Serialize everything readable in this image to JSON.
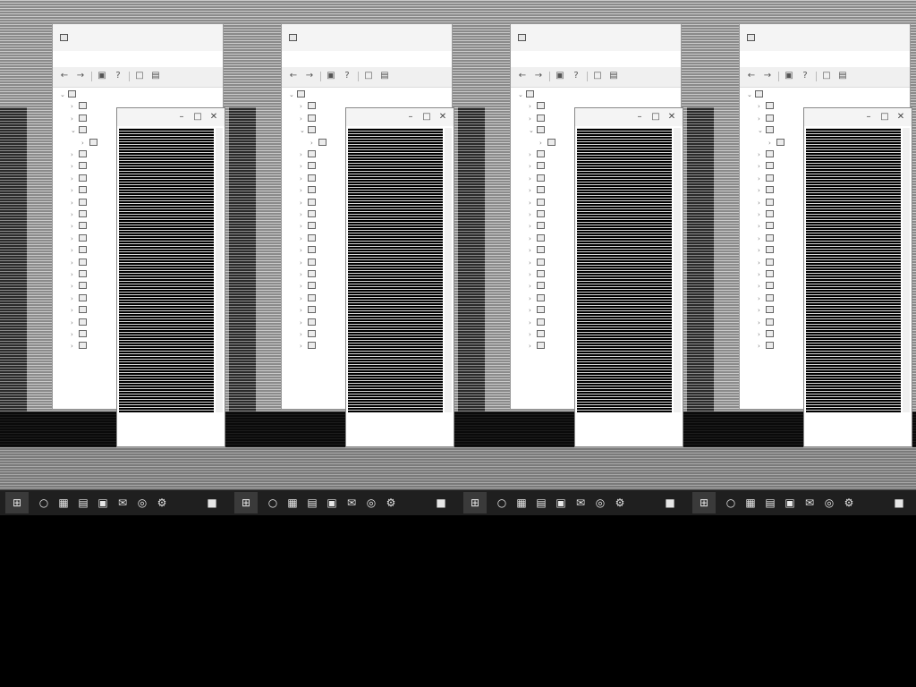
{
  "screen": {
    "panes": [
      {
        "window": {
          "title": "",
          "menu": [
            "",
            "",
            ""
          ]
        }
      },
      {
        "window": {
          "title": "",
          "menu": [
            "",
            "",
            ""
          ]
        }
      },
      {
        "window": {
          "title": "",
          "menu": [
            "",
            "",
            ""
          ]
        }
      },
      {
        "window": {
          "title": "",
          "menu": [
            "",
            "",
            ""
          ]
        }
      }
    ]
  },
  "device_manager": {
    "toolbar_icons": [
      "back-icon",
      "forward-icon",
      "properties-icon",
      "help-icon",
      "scan-icon",
      "display-icon"
    ],
    "tree_items": [
      {
        "depth": 0,
        "expanded": true
      },
      {
        "depth": 1
      },
      {
        "depth": 1
      },
      {
        "depth": 1,
        "expanded": true
      },
      {
        "depth": 2
      },
      {
        "depth": 1
      },
      {
        "depth": 1
      },
      {
        "depth": 1
      },
      {
        "depth": 1
      },
      {
        "depth": 1
      },
      {
        "depth": 1
      },
      {
        "depth": 1
      },
      {
        "depth": 1
      },
      {
        "depth": 1
      },
      {
        "depth": 1
      },
      {
        "depth": 1
      },
      {
        "depth": 1
      },
      {
        "depth": 1
      },
      {
        "depth": 1
      },
      {
        "depth": 1
      },
      {
        "depth": 1
      },
      {
        "depth": 1
      }
    ]
  },
  "properties_window": {
    "controls": [
      "minimize-icon",
      "maximize-icon",
      "close-icon"
    ]
  },
  "taskbar": {
    "items": [
      "start-button",
      "search-icon",
      "task-view-icon",
      "file-explorer-icon",
      "store-icon",
      "mail-icon",
      "browser-icon",
      "settings-icon",
      "terminal-icon"
    ]
  },
  "colors": {
    "window_bg": "#ffffff",
    "taskbar_bg": "#1f1f1f",
    "desktop_bg": "#8a8a8a"
  }
}
